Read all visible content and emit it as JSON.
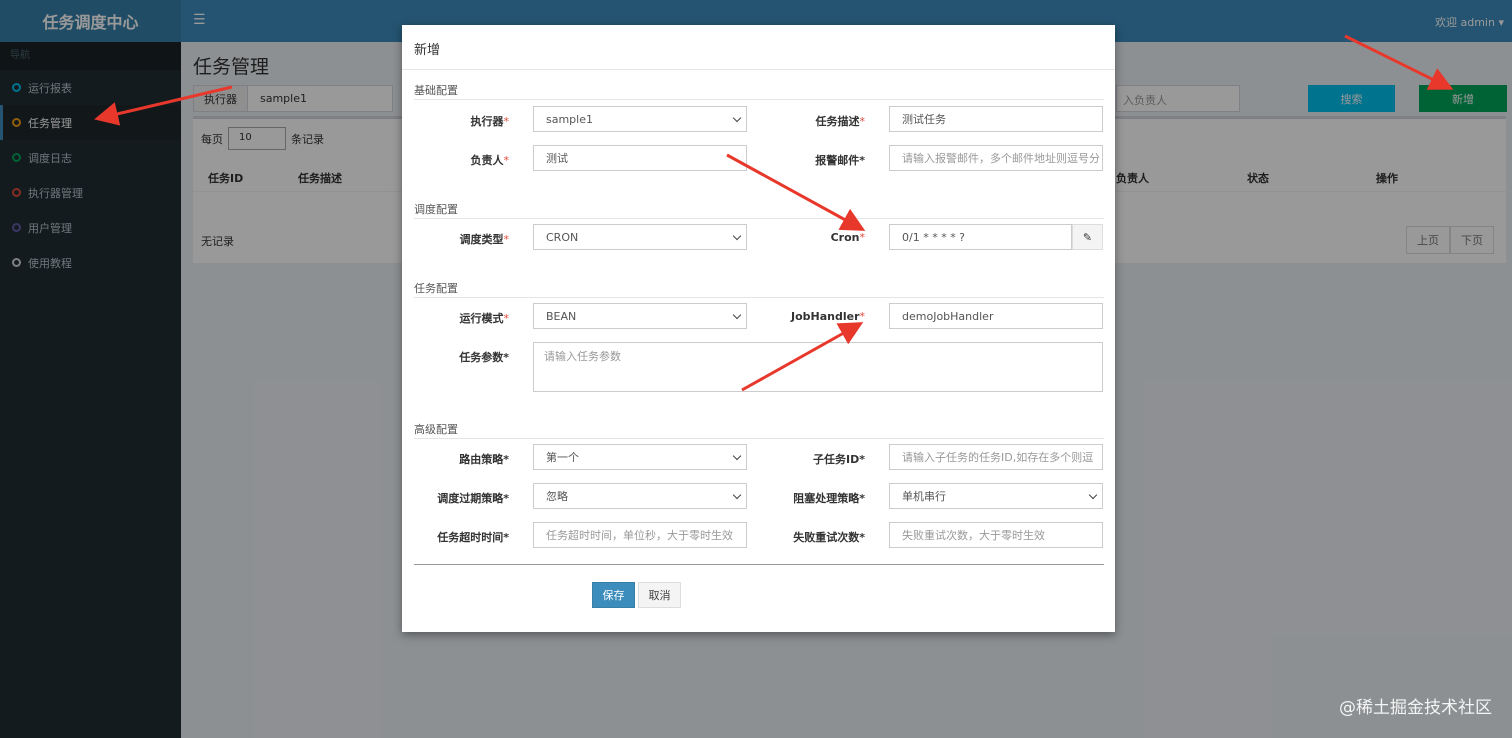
{
  "app": {
    "title": "任务调度中心"
  },
  "header": {
    "menu_icon": "☰",
    "welcome": "欢迎 admin"
  },
  "sidebar": {
    "section_label": "导航",
    "items": [
      {
        "label": "运行报表",
        "color": "#00c0ef"
      },
      {
        "label": "任务管理",
        "color": "#f39c12"
      },
      {
        "label": "调度日志",
        "color": "#00a65a"
      },
      {
        "label": "执行器管理",
        "color": "#dd4b39"
      },
      {
        "label": "用户管理",
        "color": "#605ca8"
      },
      {
        "label": "使用教程",
        "color": "#d2d6de"
      }
    ]
  },
  "page": {
    "title": "任务管理",
    "filter": {
      "label": "执行器",
      "value": "sample1"
    },
    "owner_placeholder": "入负责人",
    "search_label": "搜索",
    "add_label": "新增",
    "per_page_prefix": "每页",
    "per_page_value": "10",
    "per_page_suffix": "条记录",
    "columns": [
      "任务ID",
      "任务描述",
      "负责人",
      "状态",
      "操作"
    ],
    "empty_text": "无记录",
    "prev_label": "上页",
    "next_label": "下页"
  },
  "modal": {
    "title": "新增",
    "sections": {
      "basic": "基础配置",
      "schedule": "调度配置",
      "task": "任务配置",
      "advanced": "高级配置"
    },
    "fields": {
      "executor": {
        "label": "执行器",
        "value": "sample1"
      },
      "desc": {
        "label": "任务描述",
        "value": "测试任务"
      },
      "owner": {
        "label": "负责人",
        "value": "测试"
      },
      "alarm_email": {
        "label": "报警邮件",
        "placeholder": "请输入报警邮件，多个邮件地址则逗号分"
      },
      "schedule_type": {
        "label": "调度类型",
        "value": "CRON"
      },
      "cron": {
        "label": "Cron",
        "value": "0/1 * * * * ?"
      },
      "run_mode": {
        "label": "运行模式",
        "value": "BEAN"
      },
      "job_handler": {
        "label": "JobHandler",
        "value": "demoJobHandler"
      },
      "params": {
        "label": "任务参数",
        "placeholder": "请输入任务参数"
      },
      "route": {
        "label": "路由策略",
        "value": "第一个"
      },
      "child_id": {
        "label": "子任务ID",
        "placeholder": "请输入子任务的任务ID,如存在多个则逗"
      },
      "misfire": {
        "label": "调度过期策略",
        "value": "忽略"
      },
      "block": {
        "label": "阻塞处理策略",
        "value": "单机串行"
      },
      "timeout": {
        "label": "任务超时时间",
        "placeholder": "任务超时时间，单位秒，大于零时生效"
      },
      "retry": {
        "label": "失败重试次数",
        "placeholder": "失败重试次数，大于零时生效"
      }
    },
    "save_label": "保存",
    "cancel_label": "取消"
  },
  "watermark": "@稀土掘金技术社区",
  "colors": {
    "brand": "#3c8dbc",
    "sidebar": "#222d32",
    "success": "#00a65a",
    "info": "#00c0ef",
    "arrow": "#e8372b"
  }
}
